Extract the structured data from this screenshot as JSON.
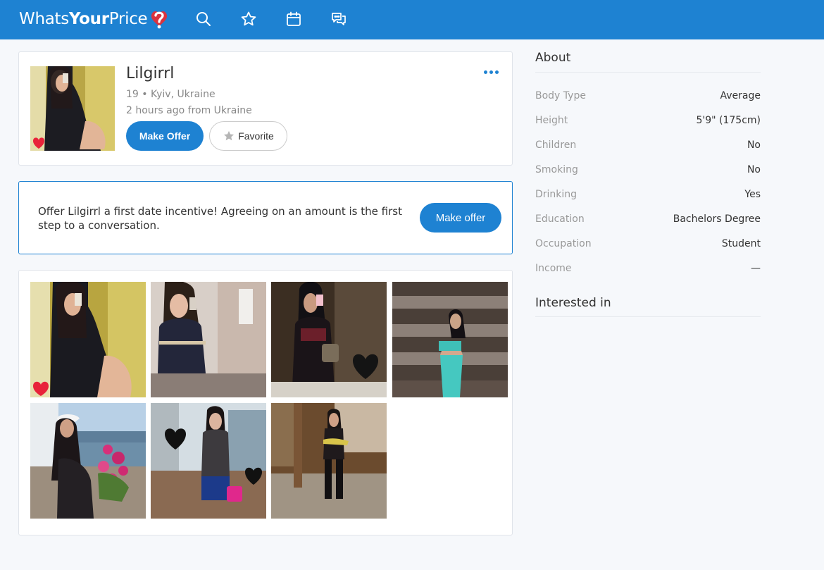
{
  "brand": {
    "part1": "Whats",
    "part2": "Your",
    "part3": "Price",
    "color": "#1e82d2",
    "heart_color": "#d9333f"
  },
  "nav": {
    "icons": [
      "search-icon",
      "star-icon",
      "calendar-icon",
      "chat-icon"
    ]
  },
  "profile": {
    "name": "Lilgirrl",
    "details": "19 • Kyiv, Ukraine",
    "last_seen": "2 hours ago from Ukraine",
    "make_offer_label": "Make Offer",
    "favorite_label": "Favorite"
  },
  "incentive": {
    "text": "Offer Lilgirrl a first date incentive! Agreeing on an amount is the first step to a conversation.",
    "button_label": "Make offer"
  },
  "about": {
    "title": "About",
    "rows": [
      {
        "label": "Body Type",
        "value": "Average"
      },
      {
        "label": "Height",
        "value": "5'9\" (175cm)"
      },
      {
        "label": "Children",
        "value": "No"
      },
      {
        "label": "Smoking",
        "value": "No"
      },
      {
        "label": "Drinking",
        "value": "Yes"
      },
      {
        "label": "Education",
        "value": "Bachelors Degree"
      },
      {
        "label": "Occupation",
        "value": "Student"
      },
      {
        "label": "Income",
        "value": "—"
      }
    ],
    "interested_title": "Interested in"
  }
}
